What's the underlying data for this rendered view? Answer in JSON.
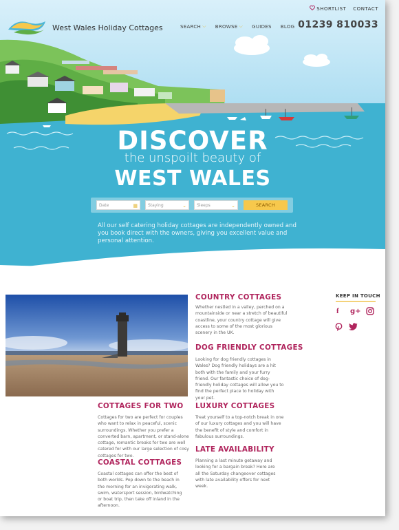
{
  "topbar": {
    "shortlist": "SHORTLIST",
    "contact": "CONTACT"
  },
  "brand": {
    "name": "West Wales Holiday Cottages"
  },
  "nav": {
    "search": "SEARCH",
    "browse": "BROWSE",
    "guides": "GUIDES",
    "blog": "BLOG"
  },
  "phone": "01239 810033",
  "hero": {
    "line1": "DISCOVER",
    "line2": "the unspoilt beauty of",
    "line3": "WEST WALES"
  },
  "search": {
    "date_placeholder": "Date",
    "staying_placeholder": "Staying",
    "sleeps_placeholder": "Sleeps",
    "button": "SEARCH"
  },
  "intro": "All our self catering holiday cottages are independently owned and you book direct with the owners, giving you excellent value and personal attention.",
  "sections": {
    "country": {
      "title": "COUNTRY COTTAGES",
      "text": "Whether nestled in a valley, perched on a mountainside or near a stretch of beautiful coastline, your country cottage will give access to some of the most glorious scenery in the UK."
    },
    "dog": {
      "title": "DOG FRIENDLY COTTAGES",
      "text": "Looking for dog friendly cottages in Wales? Dog friendly holidays are a hit both with the family and your furry friend. Our fantastic choice of dog-friendly holiday cottages will allow you to find the perfect place to holiday with your pet."
    },
    "two": {
      "title": "COTTAGES FOR TWO",
      "text": "Cottages for two are perfect for couples who want to relax in peaceful, scenic surroundings. Whether you prefer a converted barn, apartment, or stand-alone cottage, romantic breaks for two are well catered for with our large selection of cosy cottages for two."
    },
    "luxury": {
      "title": "LUXURY COTTAGES",
      "text": "Treat yourself to a top-notch break in one of our luxury cottages and you will have the benefit of style and comfort in fabulous surroundings."
    },
    "coastal": {
      "title": "COASTAL COTTAGES",
      "text": "Coastal cottages can offer the best of both worlds. Pop down to the beach in the morning for an invigorating walk, swim, watersport session, birdwatching or boat trip, then take off inland in the afternoon."
    },
    "late": {
      "title": "LATE AVAILABILITY",
      "text": "Planning a last minute getaway and looking for a bargain break? Here are all the Saturday changeover cottages with late availability offers for next week."
    }
  },
  "keep_in_touch": "KEEP IN TOUCH",
  "colors": {
    "accent": "#b0255d",
    "sea": "#3fb2d1",
    "sky": "#bfe6f6",
    "button": "#f7c84c"
  },
  "icons": [
    "heart-icon",
    "chevron-down-icon",
    "calendar-icon",
    "facebook-icon",
    "google-plus-icon",
    "instagram-icon",
    "pinterest-icon",
    "twitter-icon"
  ]
}
